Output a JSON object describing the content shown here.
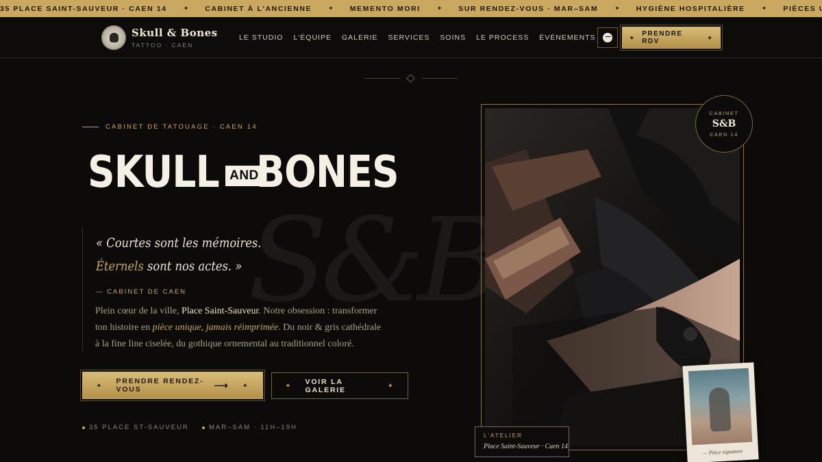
{
  "ticker": [
    "35 PLACE SAINT-SAUVEUR · CAEN 14",
    "CABINET À L'ANCIENNE",
    "MEMENTO MORI",
    "SUR RENDEZ-VOUS · MAR–SAM",
    "HYGIÈNE HOSPITALIÈRE",
    "PIÈCES UNIQUES"
  ],
  "ticker_separator": "✦",
  "brand": {
    "name": "Skull & Bones",
    "tagline": "TATTOO · CAEN"
  },
  "nav": [
    "LE STUDIO",
    "L'ÉQUIPE",
    "GALERIE",
    "SERVICES",
    "SOINS",
    "LE PROCESS",
    "ÉVÉNEMENTS"
  ],
  "header": {
    "messenger_icon": "messenger-icon",
    "cta_label": "PRENDRE RDV",
    "cta_spark": "✦"
  },
  "hero": {
    "eyebrow": "CABINET DE TATOUAGE · CAEN 14",
    "title_left": "SKULL",
    "title_and": "AND",
    "title_right": "BONES",
    "quote_line1": "« Courtes sont les mémoires.",
    "quote_line2_gold": "Éternels",
    "quote_line2_rest": " sont nos actes. »",
    "quote_cite": "— CABINET DE CAEN",
    "para_1": "Plein cœur de la ville, ",
    "para_hl": "Place Saint-Sauveur",
    "para_2": ". Notre obsession : transformer ton histoire en ",
    "para_it": "pièce unique, jamais réimprimée",
    "para_3": ". Du noir & gris cathédrale à la fine line ciselée, du gothique ornemental au traditionnel coloré.",
    "cta_primary": "PRENDRE RENDEZ-VOUS",
    "cta_primary_arrow": "⟶",
    "cta_secondary": "VOIR LA GALERIE",
    "spark": "✦",
    "meta_address": "35 PLACE ST-SAUVEUR",
    "meta_hours": "MAR–SAM · 11H–19H",
    "watermark": "S&B"
  },
  "visual": {
    "seal_top": "CABINET",
    "seal_mid": "S&B",
    "seal_bottom": "CAEN 14",
    "caption_label": "L'ATELIER",
    "caption_text": "Place Saint-Sauveur · Caen 14",
    "polaroid_caption": "— Pièce signature"
  },
  "colors": {
    "gold": "#c9a960",
    "background": "#0c0b09",
    "ivory": "#f4f0e6"
  }
}
